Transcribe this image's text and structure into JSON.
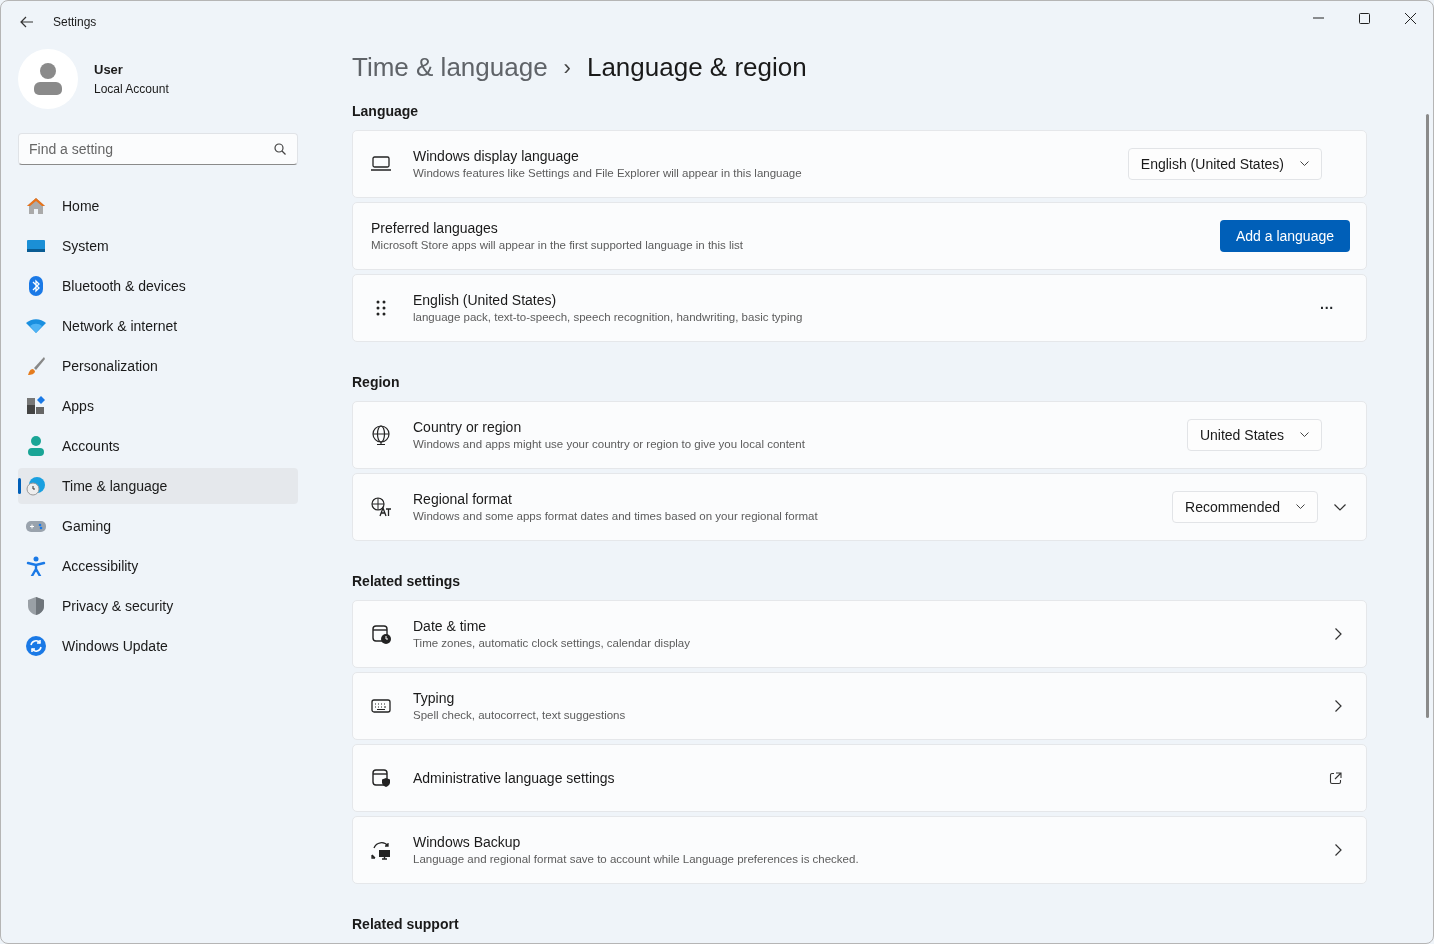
{
  "window": {
    "title": "Settings"
  },
  "user": {
    "name": "User",
    "account": "Local Account"
  },
  "search": {
    "placeholder": "Find a setting"
  },
  "sidebar": {
    "items": [
      {
        "label": "Home",
        "selected": false
      },
      {
        "label": "System",
        "selected": false
      },
      {
        "label": "Bluetooth & devices",
        "selected": false
      },
      {
        "label": "Network & internet",
        "selected": false
      },
      {
        "label": "Personalization",
        "selected": false
      },
      {
        "label": "Apps",
        "selected": false
      },
      {
        "label": "Accounts",
        "selected": false
      },
      {
        "label": "Time & language",
        "selected": true
      },
      {
        "label": "Gaming",
        "selected": false
      },
      {
        "label": "Accessibility",
        "selected": false
      },
      {
        "label": "Privacy & security",
        "selected": false
      },
      {
        "label": "Windows Update",
        "selected": false
      }
    ]
  },
  "breadcrumb": {
    "parent": "Time & language",
    "separator": "›",
    "current": "Language & region"
  },
  "sections": [
    {
      "title": "Language",
      "cards": [
        {
          "kind": "dropdown",
          "title": "Windows display language",
          "subtitle": "Windows features like Settings and File Explorer will appear in this language",
          "value": "English (United States)"
        },
        {
          "kind": "button",
          "title": "Preferred languages",
          "subtitle": "Microsoft Store apps will appear in the first supported language in this list",
          "value": "Add a language"
        },
        {
          "kind": "more",
          "title": "English (United States)",
          "subtitle": "language pack, text-to-speech, speech recognition, handwriting, basic typing",
          "value": "···"
        }
      ]
    },
    {
      "title": "Region",
      "cards": [
        {
          "kind": "dropdown",
          "title": "Country or region",
          "subtitle": "Windows and apps might use your country or region to give you local content",
          "value": "United States"
        },
        {
          "kind": "dropdown-expand",
          "title": "Regional format",
          "subtitle": "Windows and some apps format dates and times based on your regional format",
          "value": "Recommended",
          "expanded": false
        }
      ]
    },
    {
      "title": "Related settings",
      "cards": [
        {
          "kind": "link",
          "title": "Date & time",
          "subtitle": "Time zones, automatic clock settings, calendar display"
        },
        {
          "kind": "link",
          "title": "Typing",
          "subtitle": "Spell check, autocorrect, text suggestions"
        },
        {
          "kind": "external",
          "title": "Administrative language settings"
        },
        {
          "kind": "link",
          "title": "Windows Backup",
          "subtitle": "Language and regional format save to account while Language preferences is checked."
        }
      ]
    },
    {
      "title": "Related support"
    }
  ]
}
